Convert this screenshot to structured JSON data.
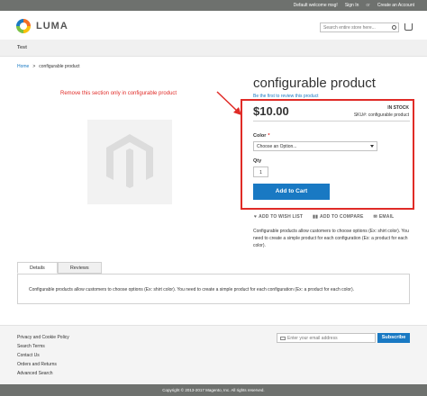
{
  "topbar": {
    "welcome": "Default welcome msg!",
    "sign_in": "Sign In",
    "or": "or",
    "create_account": "Create an Account"
  },
  "logo": {
    "text": "LUMA"
  },
  "search": {
    "placeholder": "Search entire store here..."
  },
  "nav": {
    "items": [
      "Test"
    ]
  },
  "breadcrumb": {
    "home": "Home",
    "separator": ">",
    "current": "configurable product"
  },
  "annotation": {
    "text": "Remove this section only in configurable product",
    "color": "#e02b27"
  },
  "product": {
    "title": "configurable product",
    "review_link": "Be the first to review this product",
    "price": "$10.00",
    "stock": "IN STOCK",
    "sku_label": "SKU#:",
    "sku_value": "configurable product",
    "color_label": "Color",
    "required_mark": "*",
    "color_select_value": "Choose an Option...",
    "qty_label": "Qty",
    "qty_value": "1",
    "add_to_cart": "Add to Cart",
    "actions": {
      "wishlist": "ADD TO WISH LIST",
      "compare": "ADD TO COMPARE",
      "email": "EMAIL"
    },
    "short_description": "Configurable products allow customers to choose options (Ex: shirt color). You need to create a simple product for each configuration (Ex: a product for each color)."
  },
  "tabs": {
    "items": [
      "Details",
      "Reviews"
    ],
    "active": "Details",
    "details_text": "Configurable products allow customers to choose options (Ex: shirt color). You need to create a simple product for each configuration (Ex: a product for each color)."
  },
  "footer": {
    "links": [
      "Privacy and Cookie Policy",
      "Search Terms",
      "Contact Us",
      "Orders and Returns",
      "Advanced Search"
    ],
    "newsletter_placeholder": "Enter your email address",
    "subscribe": "Subscribe",
    "copyright": "Copyright © 2013-2017 Magento, Inc. All rights reserved."
  },
  "colors": {
    "accent": "#1979c3",
    "highlight_border": "#e02b27",
    "bars": "#6e716e"
  },
  "icons": [
    "search-icon",
    "cart-icon",
    "chevron-down-icon",
    "heart-icon",
    "compare-icon",
    "envelope-icon",
    "magento-placeholder-icon"
  ]
}
